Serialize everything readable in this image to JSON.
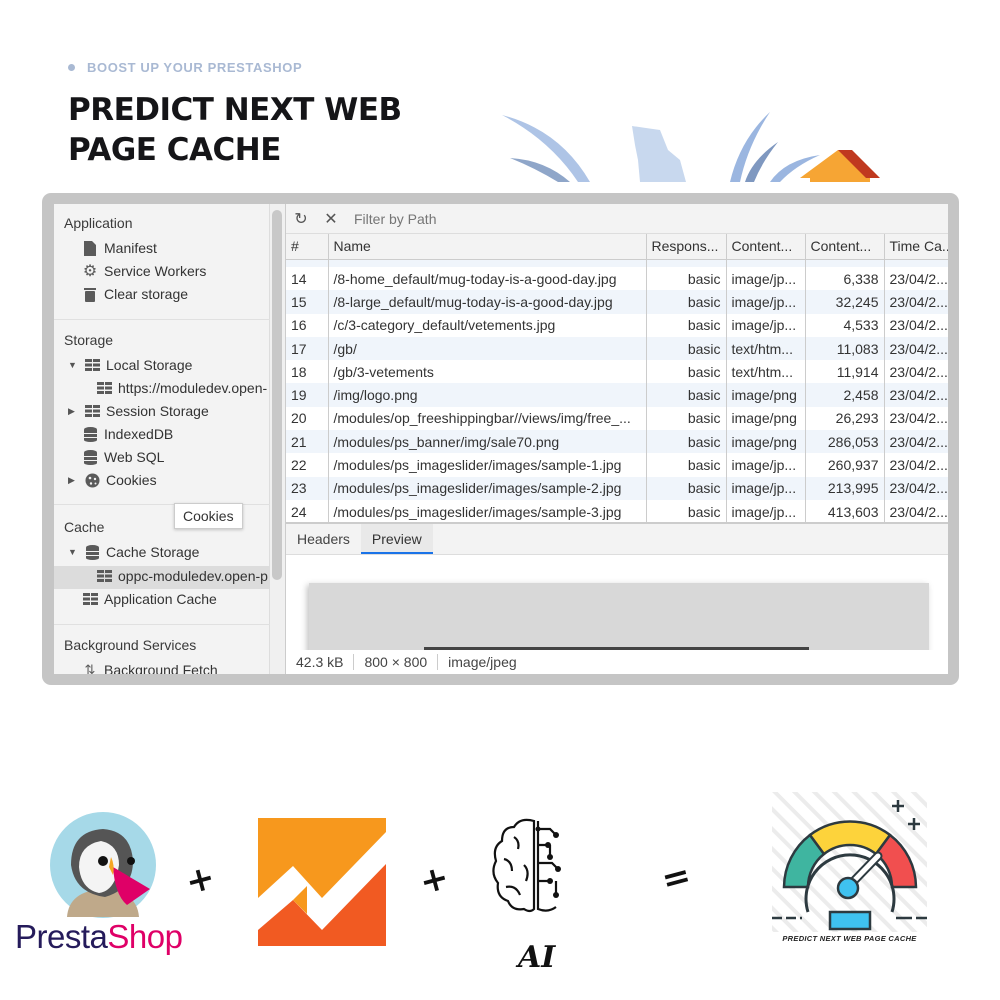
{
  "header": {
    "eyebrow": "BOOST UP YOUR PRESTASHOP",
    "title_line1": "PREDICT NEXT WEB",
    "title_line2": "PAGE CACHE"
  },
  "devtools": {
    "sidebar": {
      "sections": {
        "application": "Application",
        "storage": "Storage",
        "cache": "Cache",
        "background_services": "Background Services"
      },
      "items": {
        "manifest": "Manifest",
        "service_workers": "Service Workers",
        "clear_storage": "Clear storage",
        "local_storage": "Local Storage",
        "local_storage_origin": "https://moduledev.open-",
        "session_storage": "Session Storage",
        "indexeddb": "IndexedDB",
        "web_sql": "Web SQL",
        "cookies": "Cookies",
        "cache_storage": "Cache Storage",
        "cache_storage_entry": "oppc-moduledev.open-p",
        "application_cache": "Application Cache",
        "background_fetch": "Background Fetch"
      },
      "tooltip": "Cookies"
    },
    "toolbar": {
      "refresh_icon": "refresh-icon",
      "clear_icon": "close-icon",
      "filter_placeholder": "Filter by Path"
    },
    "table": {
      "columns": [
        "#",
        "Name",
        "Respons...",
        "Content...",
        "Content...",
        "Time Ca..."
      ],
      "rows": [
        {
          "num": "14",
          "name": "/8-home_default/mug-today-is-a-good-day.jpg",
          "response": "basic",
          "content_type": "image/jp...",
          "content_length": "6,338",
          "time": "23/04/2..."
        },
        {
          "num": "15",
          "name": "/8-large_default/mug-today-is-a-good-day.jpg",
          "response": "basic",
          "content_type": "image/jp...",
          "content_length": "32,245",
          "time": "23/04/2..."
        },
        {
          "num": "16",
          "name": "/c/3-category_default/vetements.jpg",
          "response": "basic",
          "content_type": "image/jp...",
          "content_length": "4,533",
          "time": "23/04/2..."
        },
        {
          "num": "17",
          "name": "/gb/",
          "response": "basic",
          "content_type": "text/htm...",
          "content_length": "11,083",
          "time": "23/04/2..."
        },
        {
          "num": "18",
          "name": "/gb/3-vetements",
          "response": "basic",
          "content_type": "text/htm...",
          "content_length": "11,914",
          "time": "23/04/2..."
        },
        {
          "num": "19",
          "name": "/img/logo.png",
          "response": "basic",
          "content_type": "image/png",
          "content_length": "2,458",
          "time": "23/04/2..."
        },
        {
          "num": "20",
          "name": "/modules/op_freeshippingbar//views/img/free_...",
          "response": "basic",
          "content_type": "image/png",
          "content_length": "26,293",
          "time": "23/04/2..."
        },
        {
          "num": "21",
          "name": "/modules/ps_banner/img/sale70.png",
          "response": "basic",
          "content_type": "image/png",
          "content_length": "286,053",
          "time": "23/04/2..."
        },
        {
          "num": "22",
          "name": "/modules/ps_imageslider/images/sample-1.jpg",
          "response": "basic",
          "content_type": "image/jp...",
          "content_length": "260,937",
          "time": "23/04/2..."
        },
        {
          "num": "23",
          "name": "/modules/ps_imageslider/images/sample-2.jpg",
          "response": "basic",
          "content_type": "image/jp...",
          "content_length": "213,995",
          "time": "23/04/2..."
        },
        {
          "num": "24",
          "name": "/modules/ps_imageslider/images/sample-3.jpg",
          "response": "basic",
          "content_type": "image/jp...",
          "content_length": "413,603",
          "time": "23/04/2..."
        }
      ]
    },
    "detail_tabs": [
      "Headers",
      "Preview"
    ],
    "active_detail_tab": "Preview",
    "status": {
      "size": "42.3 kB",
      "dimensions": "800 × 800",
      "mime": "image/jpeg"
    }
  },
  "equation": {
    "prestashop_part1": "Presta",
    "prestashop_part2": "Shop",
    "plus": "+",
    "equals": "=",
    "ai_label": "AI",
    "result_caption": "PREDICT NEXT WEB PAGE CACHE"
  },
  "colors": {
    "eyebrow": "#a9b9d3",
    "title": "#151518",
    "frame": "#c5c5c5",
    "row_alt": "#f0f5fb",
    "tab_accent": "#1a73e8",
    "presta_navy": "#251b5b",
    "presta_pink": "#df0067",
    "ga_orange": "#f7981d",
    "ga_dark_orange": "#f15a22"
  }
}
